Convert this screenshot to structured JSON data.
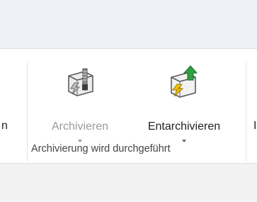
{
  "ribbon": {
    "clipped_left_label": "n",
    "clipped_right_label": "I",
    "buttons": [
      {
        "label": "Archivieren",
        "icon": "archive-box-icon",
        "enabled": false
      },
      {
        "label": "Entarchivieren",
        "icon": "unarchive-icon",
        "enabled": true
      }
    ],
    "group_label": "Archivierung wird durchgeführt"
  },
  "colors": {
    "topbar": "#eef2f8",
    "disabled_text": "#9a9a9a",
    "lightning": "#f2c100",
    "arrow_green": "#2ea043"
  }
}
